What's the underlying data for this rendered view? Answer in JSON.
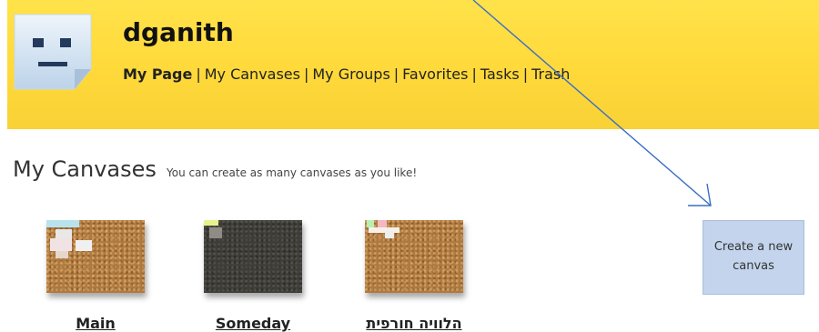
{
  "header": {
    "username": "dganith",
    "nav": [
      {
        "label": "My Page",
        "active": true
      },
      {
        "label": "My Canvases",
        "active": false
      },
      {
        "label": "My Groups",
        "active": false
      },
      {
        "label": "Favorites",
        "active": false
      },
      {
        "label": "Tasks",
        "active": false
      },
      {
        "label": "Trash",
        "active": false
      }
    ],
    "separator": "|"
  },
  "section": {
    "title": "My Canvases",
    "subtitle": "You can create as many canvases as you like!"
  },
  "canvases": [
    {
      "label": "Main",
      "style": "cork"
    },
    {
      "label": "Someday",
      "style": "dark"
    },
    {
      "label": "הלוויה חורפית",
      "style": "cork"
    }
  ],
  "create_button": {
    "line1": "Create a new",
    "line2": "canvas"
  },
  "colors": {
    "header_bg": "#ffd93a",
    "button_bg": "#c3d4ec",
    "arrow": "#3a6fc4"
  }
}
